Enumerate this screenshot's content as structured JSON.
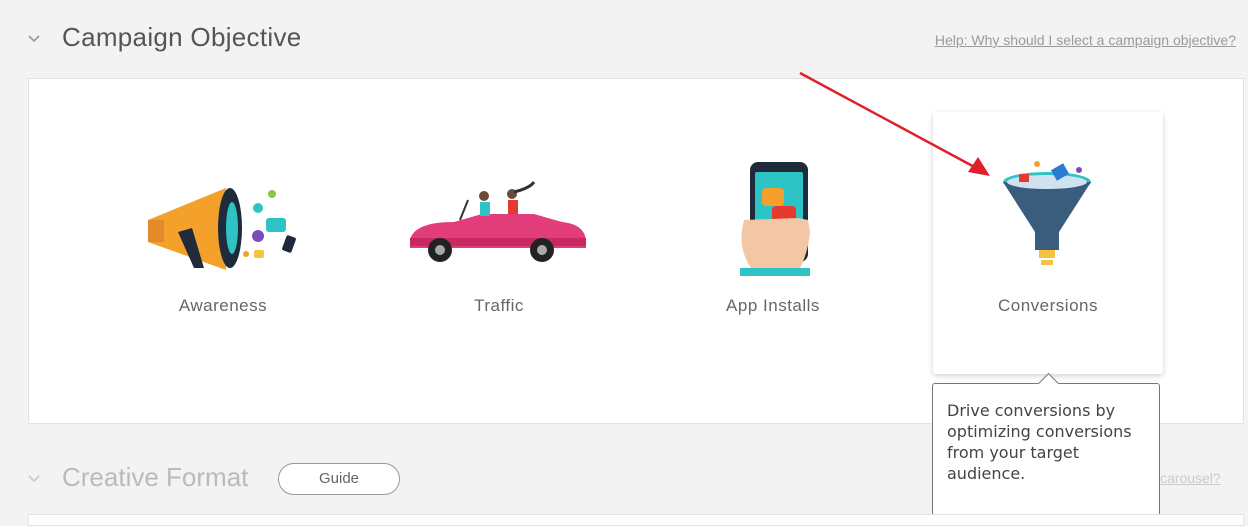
{
  "header": {
    "title": "Campaign Objective",
    "help_link": "Help: Why should I select a campaign objective?"
  },
  "objectives": [
    {
      "label": "Awareness",
      "icon": "megaphone-icon"
    },
    {
      "label": "Traffic",
      "icon": "convertible-car-icon"
    },
    {
      "label": "App Installs",
      "icon": "phone-in-hand-icon"
    },
    {
      "label": "Conversions",
      "icon": "funnel-icon",
      "selected": true
    }
  ],
  "tooltip": {
    "text": "Drive conversions by optimizing conversions from your target audience."
  },
  "creative_format": {
    "title": "Creative Format",
    "guide_label": "Guide",
    "link_fragment": "carousel?"
  },
  "colors": {
    "arrow": "#e0202a",
    "megaphone": "#f4a12b",
    "car": "#e33c7a",
    "funnel": "#3a5d7e",
    "accent": "#2ec4c6"
  }
}
